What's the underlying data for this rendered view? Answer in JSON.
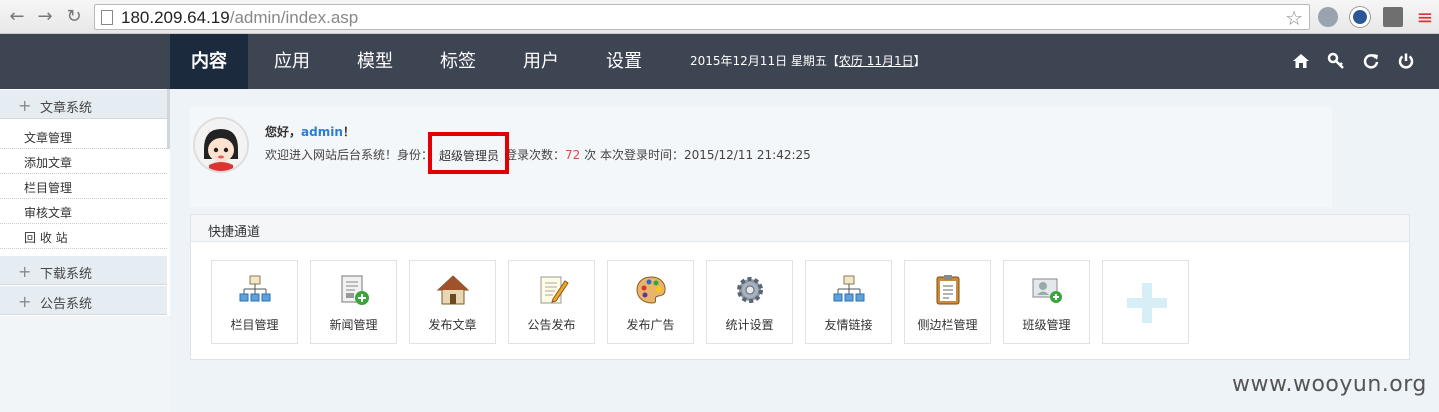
{
  "browser": {
    "url_host": "180.209.64.19",
    "url_path": "/admin/index.asp"
  },
  "topnav": {
    "tabs": [
      "内容",
      "应用",
      "模型",
      "标签",
      "用户",
      "设置"
    ],
    "date": "2015年12月11日 星期五【",
    "lunar": "农历 11月1日",
    "date_end": "】",
    "icons": [
      "home-icon",
      "key-icon",
      "refresh-icon",
      "power-icon"
    ]
  },
  "sidebar": {
    "groups": [
      {
        "label": "文章系统",
        "items": [
          "文章管理",
          "添加文章",
          "栏目管理",
          "审核文章",
          "回 收 站"
        ]
      },
      {
        "label": "下载系统",
        "items": []
      },
      {
        "label": "公告系统",
        "items": []
      }
    ]
  },
  "welcome": {
    "hello": "您好，",
    "user": "admin",
    "hello_end": "！",
    "info_prefix": "欢迎进入网站后台系统！身份：",
    "role": "超级管理员",
    "info_login": "登录次数：",
    "count": "72",
    "info_suffix": " 次 本次登录时间：2015/12/11 21:42:25"
  },
  "quick": {
    "title": "快捷通道",
    "tiles": [
      "栏目管理",
      "新闻管理",
      "发布文章",
      "公告发布",
      "发布广告",
      "统计设置",
      "友情链接",
      "侧边栏管理",
      "班级管理"
    ]
  },
  "watermark": "www.wooyun.org",
  "colors": {
    "nav_bg": "#3d4452",
    "nav_active": "#1b2a3d",
    "highlight": "#e20000",
    "accent": "#2a7fd4"
  }
}
